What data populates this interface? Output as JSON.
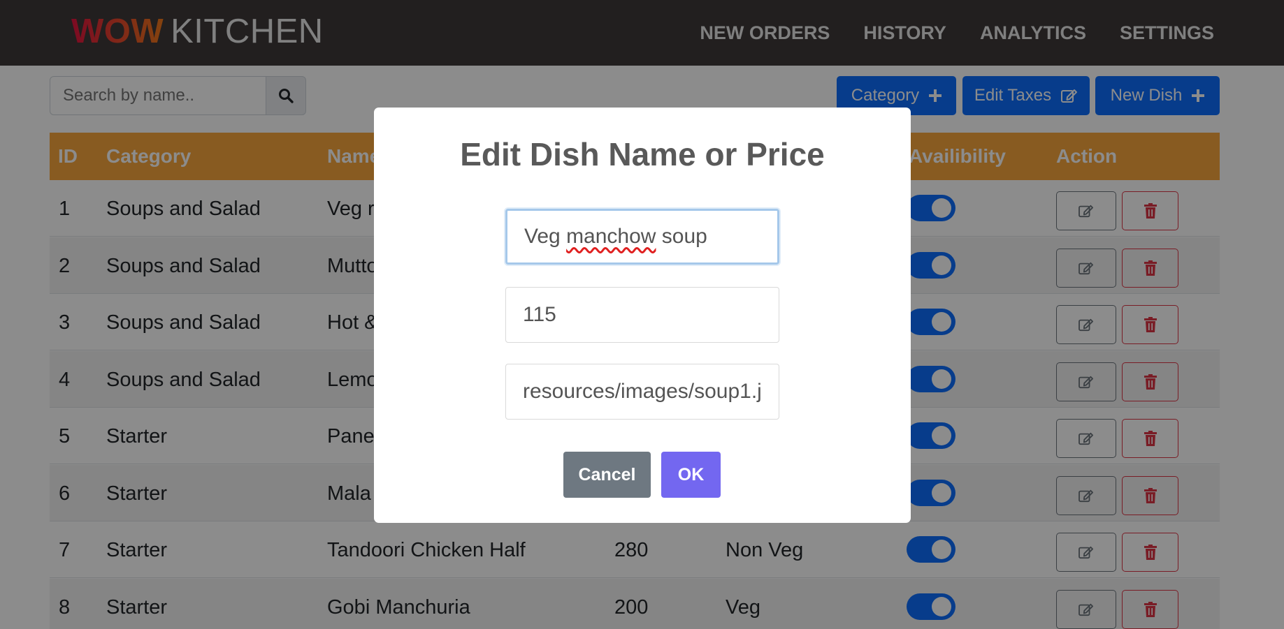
{
  "brand": {
    "wow": "WOW",
    "kitchen": "KITCHEN"
  },
  "nav": [
    "NEW ORDERS",
    "HISTORY",
    "ANALYTICS",
    "SETTINGS"
  ],
  "search": {
    "placeholder": "Search by name..",
    "icon": "search-icon"
  },
  "toolbar": {
    "category": "Category",
    "edit_taxes": "Edit Taxes",
    "new_dish": "New Dish"
  },
  "table": {
    "headers": [
      "ID",
      "Category",
      "Name",
      "Availibility",
      "Action"
    ],
    "rows": [
      {
        "id": "1",
        "category": "Soups and Salad",
        "name": "Veg r",
        "price": "",
        "type": "",
        "available": true
      },
      {
        "id": "2",
        "category": "Soups and Salad",
        "name": "Mutto",
        "price": "",
        "type": "",
        "available": true
      },
      {
        "id": "3",
        "category": "Soups and Salad",
        "name": "Hot &",
        "price": "",
        "type": "",
        "available": true
      },
      {
        "id": "4",
        "category": "Soups and Salad",
        "name": "Lemo",
        "price": "",
        "type": "",
        "available": true
      },
      {
        "id": "5",
        "category": "Starter",
        "name": "Panee",
        "price": "",
        "type": "",
        "available": true
      },
      {
        "id": "6",
        "category": "Starter",
        "name": "Mala",
        "price": "",
        "type": "",
        "available": true
      },
      {
        "id": "7",
        "category": "Starter",
        "name": "Tandoori Chicken Half",
        "price": "280",
        "type": "Non Veg",
        "available": true
      },
      {
        "id": "8",
        "category": "Starter",
        "name": "Gobi Manchuria",
        "price": "200",
        "type": "Veg",
        "available": true
      }
    ]
  },
  "modal": {
    "title": "Edit Dish Name or Price",
    "name_value": "Veg manchow soup",
    "name_misspelled_word": "manchow",
    "price_value": "115",
    "image_value": "resources/images/soup1.j",
    "cancel": "Cancel",
    "ok": "OK"
  },
  "colors": {
    "navbar": "#3f3a3a",
    "table_header": "#f7a73c",
    "primary": "#0d6efd",
    "danger": "#dc3545",
    "ok_button": "#7367f0",
    "cancel_button": "#6e7881"
  }
}
